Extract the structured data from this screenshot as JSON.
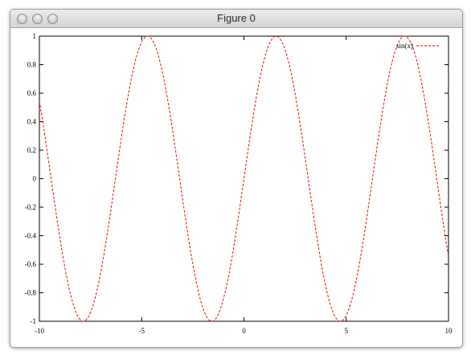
{
  "window": {
    "title": "Figure 0",
    "buttons": [
      "close",
      "minimize",
      "zoom"
    ]
  },
  "chart_data": {
    "type": "line",
    "title": "",
    "xlabel": "",
    "ylabel": "",
    "xlim": [
      -10,
      10
    ],
    "ylim": [
      -1,
      1
    ],
    "grid": false,
    "legend_position": "top-right",
    "x_ticks": [
      "-10",
      "-5",
      "0",
      "5",
      "10"
    ],
    "y_ticks": [
      "-1",
      "-0.8",
      "-0.6",
      "-0.4",
      "-0.2",
      "0",
      "0.2",
      "0.4",
      "0.6",
      "0.8",
      "1"
    ],
    "series": [
      {
        "name": "sin(x)",
        "function": "sin(x)",
        "color": "#ff0000",
        "line_style": "dashed",
        "x": [
          -10,
          -9.5,
          -9,
          -8.5,
          -8,
          -7.5,
          -7,
          -6.5,
          -6,
          -5.5,
          -5,
          -4.5,
          -4,
          -3.5,
          -3,
          -2.5,
          -2,
          -1.5,
          -1,
          -0.5,
          0,
          0.5,
          1,
          1.5,
          2,
          2.5,
          3,
          3.5,
          4,
          4.5,
          5,
          5.5,
          6,
          6.5,
          7,
          7.5,
          8,
          8.5,
          9,
          9.5,
          10
        ],
        "y": [
          0.544,
          0.075,
          -0.412,
          -0.798,
          -0.989,
          -0.938,
          -0.657,
          -0.215,
          0.279,
          0.706,
          0.959,
          0.978,
          0.757,
          0.351,
          -0.141,
          -0.598,
          -0.909,
          -0.997,
          -0.841,
          -0.479,
          0,
          0.479,
          0.841,
          0.997,
          0.909,
          0.598,
          0.141,
          -0.351,
          -0.757,
          -0.978,
          -0.959,
          -0.706,
          -0.279,
          0.215,
          0.657,
          0.938,
          0.989,
          0.798,
          0.412,
          -0.075,
          -0.544
        ]
      }
    ]
  }
}
